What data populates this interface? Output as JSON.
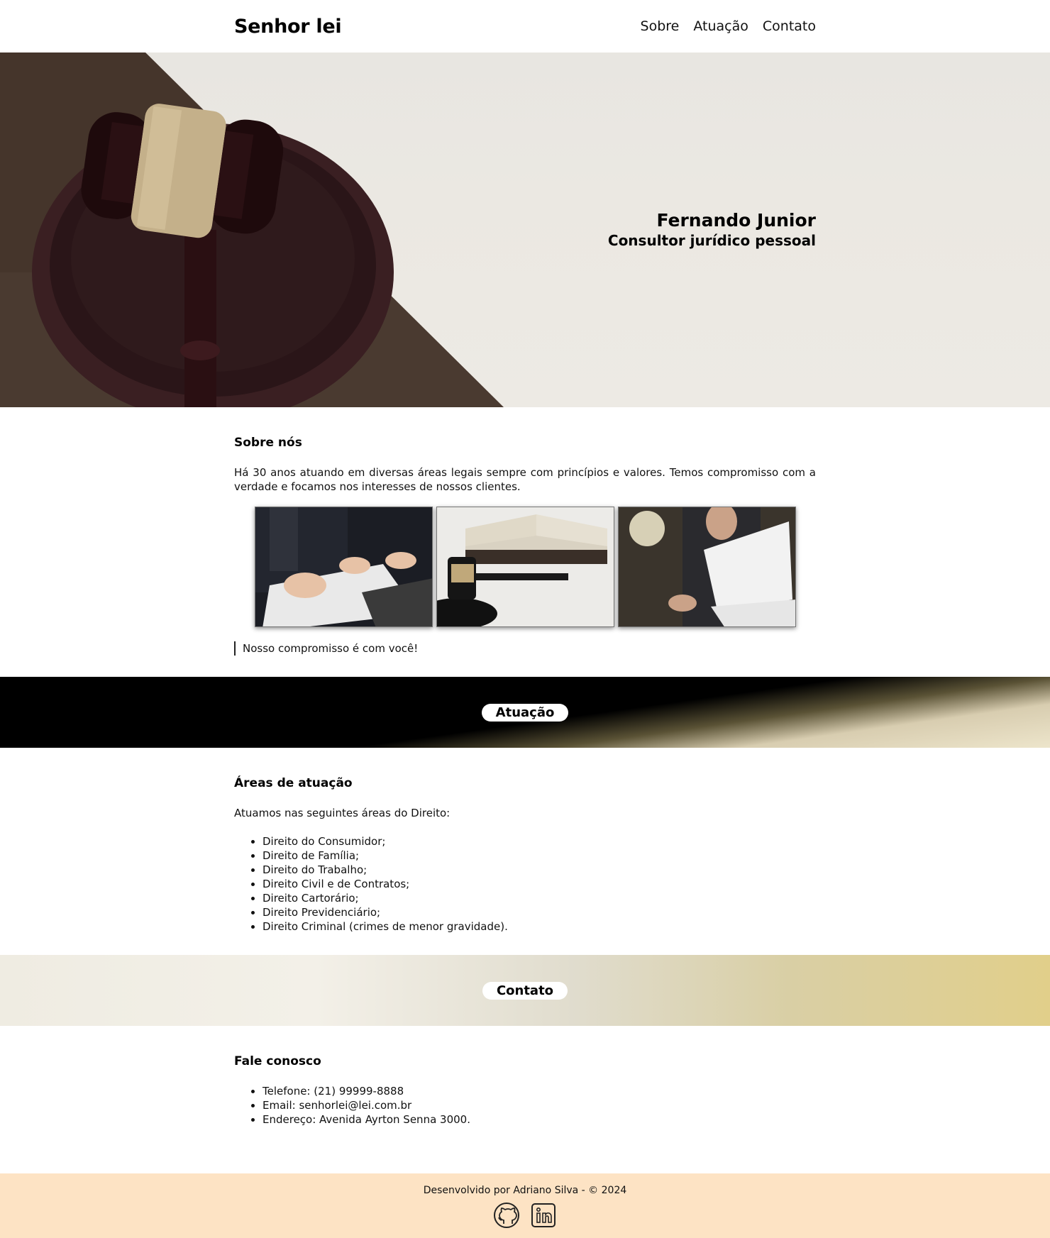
{
  "header": {
    "brand": "Senhor lei",
    "nav": [
      "Sobre",
      "Atuação",
      "Contato"
    ]
  },
  "hero": {
    "name": "Fernando Junior",
    "role": "Consultor jurídico pessoal"
  },
  "about": {
    "title": "Sobre nós",
    "text": "Há 30 anos atuando em diversas áreas legais sempre com princípios e valores. Temos compromisso com a verdade e focamos nos interesses de nossos clientes.",
    "quote": "Nosso compromisso é com você!"
  },
  "banner_atuacao": "Atuação",
  "areas": {
    "title": "Áreas de atuação",
    "intro": "Atuamos nas seguintes áreas do Direito:",
    "items": [
      "Direito do Consumidor;",
      "Direito de Família;",
      "Direito do Trabalho;",
      "Direito Civil e de Contratos;",
      "Direito Cartorário;",
      "Direito Previdenciário;",
      "Direito Criminal (crimes de menor gravidade)."
    ]
  },
  "banner_contato": "Contato",
  "contact": {
    "title": "Fale conosco",
    "items": [
      "Telefone: (21) 99999-8888",
      "Email: senhorlei@lei.com.br",
      "Endereço: Avenida Ayrton Senna 3000."
    ]
  },
  "footer": {
    "credit": "Desenvolvido por Adriano Silva - © 2024",
    "icons": [
      "github-icon",
      "linkedin-icon"
    ]
  }
}
